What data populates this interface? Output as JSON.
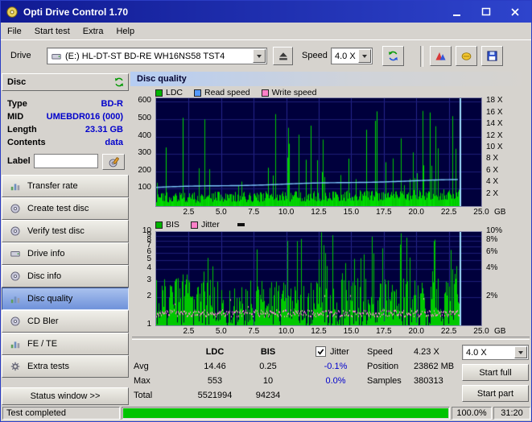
{
  "window": {
    "title": "Opti Drive Control 1.70"
  },
  "menu": {
    "items": [
      "File",
      "Start test",
      "Extra",
      "Help"
    ]
  },
  "toolbar": {
    "drive_label": "Drive",
    "drive_value": "(E:)  HL-DT-ST BD-RE  WH16NS58 TST4",
    "speed_label": "Speed",
    "speed_value": "4.0 X"
  },
  "sidebar": {
    "disc_header": "Disc",
    "info": [
      {
        "label": "Type",
        "value": "BD-R"
      },
      {
        "label": "MID",
        "value": "UMEBDR016 (000)"
      },
      {
        "label": "Length",
        "value": "23.31 GB"
      },
      {
        "label": "Contents",
        "value": "data"
      }
    ],
    "label_caption": "Label",
    "label_value": "",
    "buttons": [
      "Transfer rate",
      "Create test disc",
      "Verify test disc",
      "Drive info",
      "Disc info",
      "Disc quality",
      "CD Bler",
      "FE / TE",
      "Extra tests"
    ],
    "active_button": "Disc quality",
    "status_window": "Status window >>"
  },
  "main": {
    "panel_title": "Disc quality",
    "legend1": [
      {
        "label": "LDC",
        "color": "#00b400"
      },
      {
        "label": "Read speed",
        "color": "#5599ff"
      },
      {
        "label": "Write speed",
        "color": "#ff80c8"
      }
    ],
    "legend2": [
      {
        "label": "BIS",
        "color": "#00b400"
      },
      {
        "label": "Jitter",
        "color": "#ff80c8"
      }
    ]
  },
  "stats": {
    "col_ldc": "LDC",
    "col_bis": "BIS",
    "jitter_label": "Jitter",
    "rows": [
      {
        "label": "Avg",
        "ldc": "14.46",
        "bis": "0.25",
        "jitter": "-0.1%"
      },
      {
        "label": "Max",
        "ldc": "553",
        "bis": "10",
        "jitter": "0.0%"
      },
      {
        "label": "Total",
        "ldc": "5521994",
        "bis": "94234",
        "jitter": ""
      }
    ],
    "speed_label": "Speed",
    "speed_value": "4.23 X",
    "position_label": "Position",
    "position_value": "23862 MB",
    "samples_label": "Samples",
    "samples_value": "380313",
    "speed_select": "4.0 X",
    "start_full": "Start full",
    "start_part": "Start part"
  },
  "statusbar": {
    "text": "Test completed",
    "percent": "100.0%",
    "time": "31:20",
    "progress": 100
  },
  "chart_data": [
    {
      "type": "bar",
      "name": "ldc-read-speed",
      "x_ticks": [
        "2.5",
        "5.0",
        "7.5",
        "10.0",
        "12.5",
        "15.0",
        "17.5",
        "20.0",
        "22.5",
        "25.0"
      ],
      "x_unit": "GB",
      "xlim": [
        0,
        25
      ],
      "data_end_x": 23.31,
      "left_ticks": [
        100,
        200,
        300,
        400,
        500,
        600
      ],
      "left_max": 620,
      "right_ticks": [
        "18 X",
        "16 X",
        "14 X",
        "12 X",
        "10 X",
        "8 X",
        "6 X",
        "4 X",
        "2 X"
      ],
      "right_max": 18.6,
      "bar_color": "#00c800",
      "alt_bar_color": "#00dc00",
      "read_speed_color": "#7ec8ff",
      "read_speed_start": 108,
      "read_speed_end": 152,
      "end_line_color": "#9fe0ff",
      "bg": "#00003c",
      "grid_color": "#26268c",
      "seed": 1234,
      "avg": 14.46,
      "max": 553,
      "total": 5521994
    },
    {
      "type": "bar",
      "name": "bis-jitter",
      "x_ticks": [
        "2.5",
        "5.0",
        "7.5",
        "10.0",
        "12.5",
        "15.0",
        "17.5",
        "20.0",
        "22.5",
        "25.0"
      ],
      "x_unit": "GB",
      "xlim": [
        0,
        25
      ],
      "data_end_x": 23.31,
      "left_ticks": [
        10,
        9,
        8,
        7,
        6,
        5,
        4,
        3,
        2,
        1
      ],
      "scale": "log",
      "right_ticks": [
        "10%",
        "8%",
        "6%",
        "4%",
        "2%"
      ],
      "bar_color": "#00c800",
      "jitter_color": "#ff8ad0",
      "jitter_band": [
        1.26,
        1.48
      ],
      "end_line_color": "#9fe0ff",
      "bg": "#00003c",
      "grid_color": "#26268c",
      "seed": 987,
      "avg_bis": 0.25,
      "max_bis": 10,
      "total_bis": 94234,
      "avg_jitter_pct": -0.1,
      "max_jitter_pct": 0.0
    }
  ]
}
